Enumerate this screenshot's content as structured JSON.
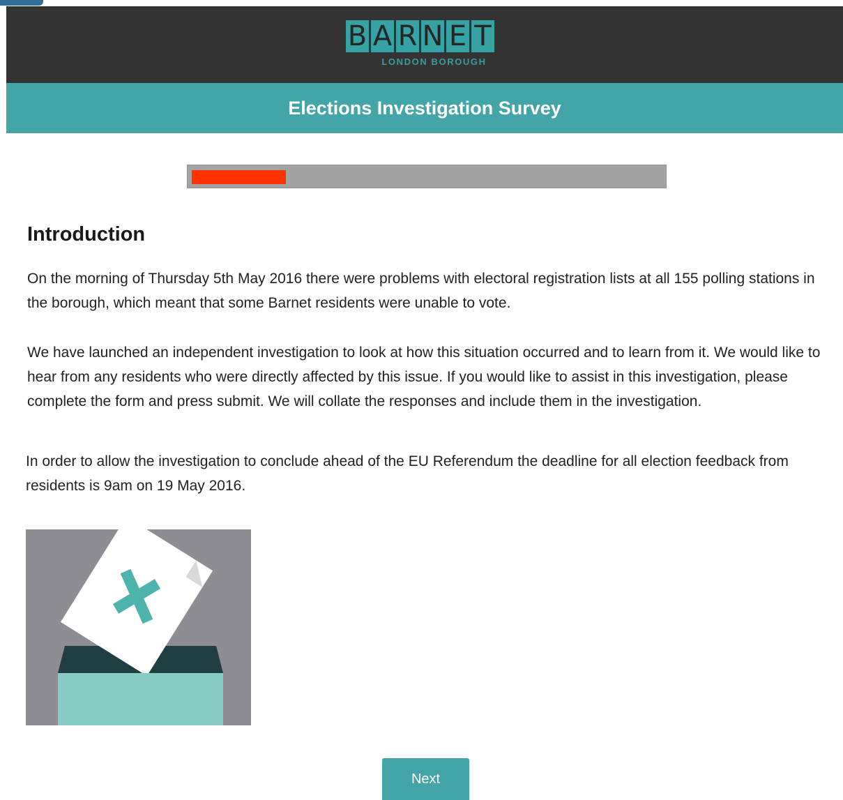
{
  "header": {
    "logo_letters": [
      "B",
      "A",
      "R",
      "N",
      "E",
      "T"
    ],
    "logo_subtitle": "LONDON BOROUGH",
    "title": "Elections Investigation Survey"
  },
  "progress": {
    "fraction": 0.2,
    "fill_color": "#ff3300"
  },
  "content": {
    "heading": "Introduction",
    "paragraphs": [
      "On the morning of Thursday 5th May 2016  there were problems with electoral registration lists at all 155 polling stations in the borough, which meant that some Barnet residents were unable to vote.",
      "We have launched an independent investigation to look at how this situation occurred and to learn from it. We would like to hear from any residents who were directly affected by this issue. If you would like to assist in this investigation, please complete the form and press submit.  We will collate the responses and include them in the investigation.",
      "In order to allow the investigation to conclude ahead of the EU Referendum the deadline for all election feedback from residents is 9am on 19 May 2016."
    ],
    "image_icon": "ballot-box-icon"
  },
  "buttons": {
    "next_label": "Next"
  },
  "colors": {
    "header_bg": "#333333",
    "teal": "#43a5a8",
    "progress_track": "#a3a3a3",
    "progress_fill": "#ff3300"
  }
}
